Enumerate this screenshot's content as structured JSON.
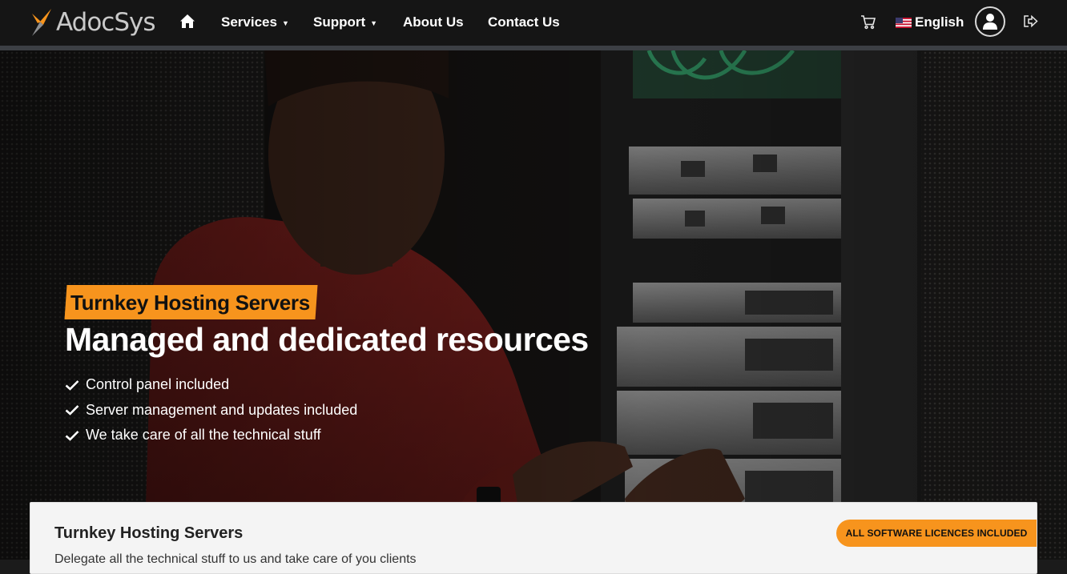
{
  "navbar": {
    "brand": "AdocSys",
    "items": [
      {
        "label": "Services",
        "has_dropdown": true
      },
      {
        "label": "Support",
        "has_dropdown": true
      },
      {
        "label": "About Us",
        "has_dropdown": false
      },
      {
        "label": "Contact Us",
        "has_dropdown": false
      }
    ],
    "language": "English",
    "icons": [
      "home-icon",
      "cart-icon",
      "us-flag-icon",
      "user-icon",
      "logout-icon"
    ]
  },
  "hero": {
    "tag": "Turnkey Hosting Servers",
    "title": "Managed and dedicated resources",
    "features": [
      "Control panel included",
      "Server management and updates included",
      "We take care of all the technical stuff"
    ]
  },
  "card": {
    "title": "Turnkey Hosting Servers",
    "description": "Delegate all the technical stuff to us and take care of you clients",
    "badge": "ALL SOFTWARE LICENCES INCLUDED"
  },
  "colors": {
    "accent": "#f7941d",
    "navbar": "#151515",
    "card_bg": "#f4f4f4"
  }
}
